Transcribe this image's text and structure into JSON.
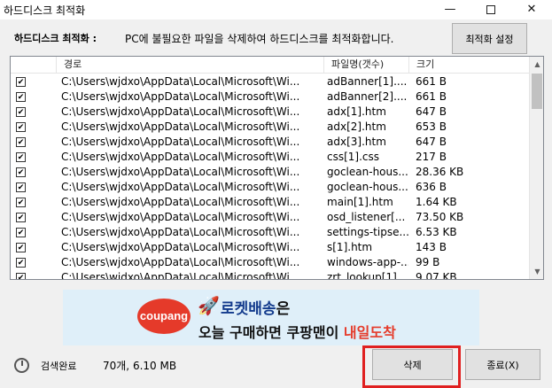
{
  "window": {
    "title": "하드디스크 최적화"
  },
  "header": {
    "label": "하드디스크 최적화 :",
    "description": "PC에 불필요한 파일을 삭제하여 하드디스크를 최적화합니다.",
    "settings_button": "최적화 설정"
  },
  "table": {
    "columns": [
      "",
      "경로",
      "파일명(갯수)",
      "크기"
    ],
    "rows": [
      {
        "checked": true,
        "path": "C:\\Users\\wjdxo\\AppData\\Local\\Microsoft\\Wi...",
        "name": "adBanner[1]....",
        "size": "661 B"
      },
      {
        "checked": true,
        "path": "C:\\Users\\wjdxo\\AppData\\Local\\Microsoft\\Wi...",
        "name": "adBanner[2]....",
        "size": "661 B"
      },
      {
        "checked": true,
        "path": "C:\\Users\\wjdxo\\AppData\\Local\\Microsoft\\Wi...",
        "name": "adx[1].htm",
        "size": "647 B"
      },
      {
        "checked": true,
        "path": "C:\\Users\\wjdxo\\AppData\\Local\\Microsoft\\Wi...",
        "name": "adx[2].htm",
        "size": "653 B"
      },
      {
        "checked": true,
        "path": "C:\\Users\\wjdxo\\AppData\\Local\\Microsoft\\Wi...",
        "name": "adx[3].htm",
        "size": "647 B"
      },
      {
        "checked": true,
        "path": "C:\\Users\\wjdxo\\AppData\\Local\\Microsoft\\Wi...",
        "name": "css[1].css",
        "size": "217 B"
      },
      {
        "checked": true,
        "path": "C:\\Users\\wjdxo\\AppData\\Local\\Microsoft\\Wi...",
        "name": "goclean-hous...",
        "size": "28.36 KB"
      },
      {
        "checked": true,
        "path": "C:\\Users\\wjdxo\\AppData\\Local\\Microsoft\\Wi...",
        "name": "goclean-hous...",
        "size": "636 B"
      },
      {
        "checked": true,
        "path": "C:\\Users\\wjdxo\\AppData\\Local\\Microsoft\\Wi...",
        "name": "main[1].htm",
        "size": "1.64 KB"
      },
      {
        "checked": true,
        "path": "C:\\Users\\wjdxo\\AppData\\Local\\Microsoft\\Wi...",
        "name": "osd_listener[...",
        "size": "73.50 KB"
      },
      {
        "checked": true,
        "path": "C:\\Users\\wjdxo\\AppData\\Local\\Microsoft\\Wi...",
        "name": "settings-tipse...",
        "size": "6.53 KB"
      },
      {
        "checked": true,
        "path": "C:\\Users\\wjdxo\\AppData\\Local\\Microsoft\\Wi...",
        "name": "s[1].htm",
        "size": "143 B"
      },
      {
        "checked": true,
        "path": "C:\\Users\\wjdxo\\AppData\\Local\\Microsoft\\Wi...",
        "name": "windows-app-...",
        "size": "99 B"
      },
      {
        "checked": true,
        "path": "C:\\Users\\wjdxo\\AppData\\Local\\Microsoft\\Wi...",
        "name": "zrt_lookup[1]....",
        "size": "9.07 KB"
      }
    ]
  },
  "ad": {
    "brand": "coupang",
    "line1_highlight": "로켓배송",
    "line1_suffix": "은",
    "line2_prefix": "오늘 구매하면 쿠팡맨이 ",
    "line2_accent": "내일도착"
  },
  "status": {
    "label": "검색완료",
    "count": "70개, 6.10 MB"
  },
  "buttons": {
    "delete": "삭제",
    "exit": "종료(X)"
  },
  "colors": {
    "highlight_box": "#e02020",
    "ad_background": "#dfeff9",
    "coupang_red": "#e53a2a",
    "ad_blue": "#123a8c"
  }
}
